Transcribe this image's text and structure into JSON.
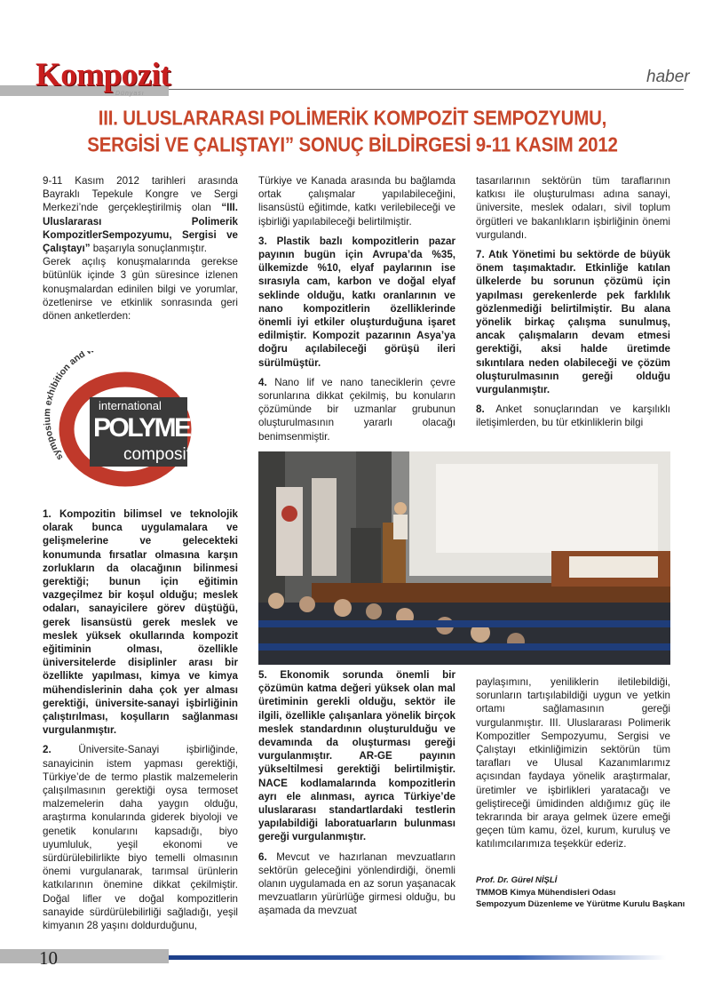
{
  "header": {
    "logo": "Kompozit",
    "logo_sub": "Dünyası",
    "section": "haber"
  },
  "title": {
    "line1": "III. ULUSLARARASI POLİMERİK KOMPOZİT SEMPOZYUMU,",
    "line2": "SERGİSİ VE ÇALIŞTAYI” SONUÇ BİLDİRGESİ 9-11 KASIM 2012"
  },
  "col1": {
    "intro_a": "9-11 Kasım 2012 tarihleri arasında Bayraklı Tepekule Kongre ve Sergi Merkezi’nde gerçekleştirilmiş olan ",
    "intro_b": "“III. Uluslararası Polimerik KompozitlerSempozyumu, Sergisi ve Çalıştayı”",
    "intro_c": " başarıyla sonuçlanmıştır.",
    "intro_p2": "Gerek açılış konuşmalarında gerekse bütünlük içinde 3 gün süresince izlenen konuşmalardan edinilen bilgi ve yorumlar, özetlenirse ve etkinlik sonrasında geri dönen anketlerden:",
    "item1_num": "1.",
    "item1": "Kompozitin bilimsel ve teknolojik olarak bunca uygulamalara ve gelişmelerine ve gelecekteki konumunda fırsatlar olmasına karşın zorlukların da olacağının bilinmesi gerektiği; bunun için eğitimin vazgeçilmez bir koşul olduğu; meslek odaları, sanayicilere görev düştüğü, gerek lisansüstü gerek meslek ve meslek yüksek okullarında kompozit eğitiminin olması, özellikle üniversitelerde disiplinler arası bir özellikte yapılması, kimya ve kimya mühendislerinin daha çok yer alması gerektiği, üniversite-sanayi işbirliğinin çalıştırılması, koşulların sağlanması vurgulanmıştır.",
    "item2_num": "2.",
    "item2": "Üniversite-Sanayi işbirliğinde, sanayicinin istem yapması gerektiği, Türkiye’de de termo plastik malzemelerin çalışılmasının gerektiği oysa termoset malzemelerin daha yaygın olduğu, araştırma konularında giderek biyoloji ve genetik konularını kapsadığı, biyo uyumluluk, yeşil ekonomi ve sürdürülebilirlikte biyo temelli olmasının önemi vurgulanarak, tarımsal ürünlerin katkılarının önemine dikkat çekilmiştir. Doğal lifler ve doğal kompozitlerin sanayide sürdürülebilirliği sağladığı, yeşil kimyanın 28 yaşını doldurduğunu,"
  },
  "col2": {
    "p_top": "Türkiye ve Kanada arasında bu bağlamda ortak çalışmalar yapılabileceğini, lisansüstü eğitimde, katkı verilebileceği ve işbirliği yapılabileceği belirtilmiştir.",
    "item3_num": "3.",
    "item3": "Plastik bazlı kompozitlerin pazar payının bugün için Avrupa’da %35, ülkemizde %10, elyaf paylarının ise sırasıyla cam, karbon ve doğal elyaf seklinde olduğu, katkı oranlarının ve nano kompozitlerin özelliklerinde önemli iyi etkiler oluşturduğuna işaret edilmiştir. Kompozit pazarının Asya’ya doğru açılabileceği görüşü ileri sürülmüştür.",
    "item4_num": "4.",
    "item4": "Nano lif ve nano taneciklerin çevre sorunlarına dikkat çekilmiş, bu konuların çözümünde bir uzmanlar grubunun oluşturulmasının yararlı olacağı benimsenmiştir.",
    "item5_num": "5.",
    "item5": "Ekonomik sorunda önemli bir çözümün katma değeri yüksek olan mal üretiminin gerekli olduğu, sektör ile ilgili, özellikle çalışanlara yönelik birçok meslek standardının oluşturulduğu ve devamında da oluşturması gereği vurgulanmıştır. AR-GE payının yükseltilmesi gerektiği belirtilmiştir. NACE kodlamalarında kompozitlerin ayrı ele alınması, ayrıca Türkiye’de uluslararası standartlardaki testlerin yapılabildiği laboratuarların bulunması gereği vurgulanmıştır.",
    "item6_num": "6.",
    "item6": "Mevcut ve hazırlanan mevzuatların sektörün geleceğini yönlendirdiği, önemli olanın uygulamada en az sorun yaşanacak mevzuatların yürürlüğe girmesi olduğu, bu aşamada da mevzuat"
  },
  "col3": {
    "p_top": "tasarılarının sektörün tüm taraflarının katkısı ile oluşturulması adına sanayi, üniversite, meslek odaları, sivil toplum örgütleri ve bakanlıkların işbirliğinin önemi vurgulandı.",
    "item7_num": "7.",
    "item7": "Atık Yönetimi bu sektörde de büyük önem taşımaktadır. Etkinliğe katılan ülkelerde bu sorunun çözümü için yapılması gerekenlerde pek farklılık gözlenmediği belirtilmiştir. Bu alana yönelik birkaç çalışma sunulmuş, ancak çalışmaların devam etmesi gerektiği, aksi halde üretimde sıkıntılara neden olabileceği ve çözüm oluşturulmasının gereği olduğu vurgulanmıştır.",
    "item8_num": "8.",
    "item8": "Anket sonuçlarından ve karşılıklı iletişimlerden, bu tür etkinliklerin bilgi",
    "p_bottom": "paylaşımını, yeniliklerin iletilebildiği, sorunların tartışılabildiği uygun ve yetkin ortamı sağlamasının gereği vurgulanmıştır. III. Uluslararası Polimerik Kompozitler Sempozyumu, Sergisi ve Çalıştayı etkinliğimizin sektörün tüm tarafları ve Ulusal Kazanımlarımız açısından faydaya yönelik araştırmalar, üretimler ve işbirlikleri yaratacağı ve geliştireceği ümidinden aldığımız güç ile tekrarında bir araya gelmek üzere emeği geçen tüm kamu, özel, kurum, kuruluş ve katılımcılarımıza teşekkür ederiz."
  },
  "signature": {
    "name": "Prof. Dr. Gürel NİŞLİ",
    "org": "TMMOB Kimya Mühendisleri Odası",
    "role": "Sempozyum Düzenleme ve Yürütme Kurulu Başkanı"
  },
  "polymeric_logo": {
    "arc_text": "symposium exhibition and workshop",
    "line1": "international",
    "line2": "POLYMERIC",
    "line3": "composites"
  },
  "footer": {
    "page_number": "10"
  },
  "colors": {
    "title": "#c8462a",
    "logo": "#c81e1e",
    "logo_ring": "#c0392b",
    "footer_blue": "#1d3f8a"
  }
}
